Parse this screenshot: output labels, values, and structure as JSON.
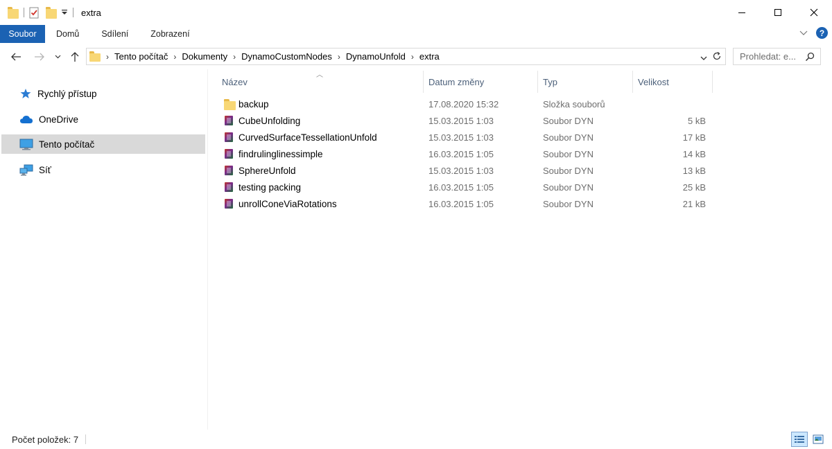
{
  "window": {
    "title": "extra"
  },
  "ribbon": {
    "tabs": [
      "Soubor",
      "Domů",
      "Sdílení",
      "Zobrazení"
    ]
  },
  "address": {
    "crumbs": [
      "Tento počítač",
      "Dokumenty",
      "DynamoCustomNodes",
      "DynamoUnfold",
      "extra"
    ]
  },
  "search": {
    "placeholder": "Prohledat: e..."
  },
  "nav": {
    "items": [
      {
        "label": "Rychlý přístup",
        "icon": "star-icon"
      },
      {
        "label": "OneDrive",
        "icon": "cloud-icon"
      },
      {
        "label": "Tento počítač",
        "icon": "computer-icon",
        "selected": true
      },
      {
        "label": "Síť",
        "icon": "network-icon"
      }
    ]
  },
  "columns": {
    "name": "Název",
    "date": "Datum změny",
    "type": "Typ",
    "size": "Velikost"
  },
  "files": [
    {
      "name": "backup",
      "date": "17.08.2020 15:32",
      "type": "Složka souborů",
      "size": "",
      "icon": "folder-icon"
    },
    {
      "name": "CubeUnfolding",
      "date": "15.03.2015 1:03",
      "type": "Soubor DYN",
      "size": "5 kB",
      "icon": "dyn-file-icon"
    },
    {
      "name": "CurvedSurfaceTessellationUnfold",
      "date": "15.03.2015 1:03",
      "type": "Soubor DYN",
      "size": "17 kB",
      "icon": "dyn-file-icon"
    },
    {
      "name": "findrulinglinessimple",
      "date": "16.03.2015 1:05",
      "type": "Soubor DYN",
      "size": "14 kB",
      "icon": "dyn-file-icon"
    },
    {
      "name": "SphereUnfold",
      "date": "15.03.2015 1:03",
      "type": "Soubor DYN",
      "size": "13 kB",
      "icon": "dyn-file-icon"
    },
    {
      "name": "testing packing",
      "date": "16.03.2015 1:05",
      "type": "Soubor DYN",
      "size": "25 kB",
      "icon": "dyn-file-icon"
    },
    {
      "name": "unrollConeViaRotations",
      "date": "16.03.2015 1:05",
      "type": "Soubor DYN",
      "size": "21 kB",
      "icon": "dyn-file-icon"
    }
  ],
  "status": {
    "text": "Počet položek: 7"
  },
  "colors": {
    "accent": "#1b62b3",
    "folder": "#f8d775",
    "selection": "#d9d9d9",
    "header_text": "#4c607a"
  }
}
